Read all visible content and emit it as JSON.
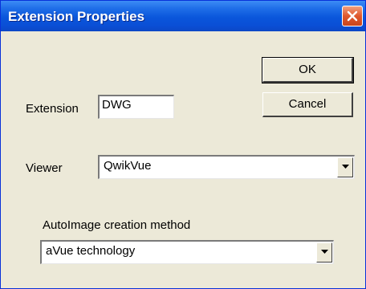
{
  "window": {
    "title": "Extension Properties"
  },
  "fields": {
    "extension_label": "Extension",
    "extension_value": "DWG",
    "viewer_label": "Viewer",
    "viewer_value": "QwikVue",
    "autoimage_label": "AutoImage creation method",
    "autoimage_value": "aVue technology"
  },
  "buttons": {
    "ok": "OK",
    "cancel": "Cancel"
  },
  "icons": {
    "close": "close-icon",
    "dropdown": "chevron-down-icon"
  },
  "colors": {
    "titlebar": "#0a56db",
    "close_button": "#e0582d",
    "dialog_background": "#ece9d8"
  }
}
